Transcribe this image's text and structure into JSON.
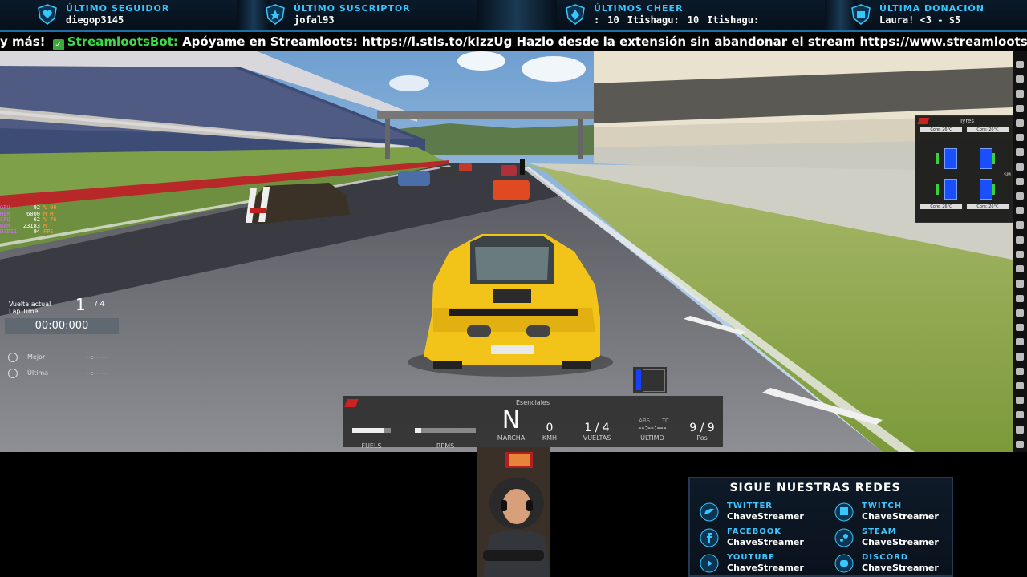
{
  "top_banner": {
    "follower": {
      "label": "ÚLTIMO SEGUIDOR",
      "value": "diegop3145"
    },
    "subscriber": {
      "label": "ÚLTIMO SUSCRIPTOR",
      "value": "jofal93"
    },
    "cheers": {
      "label": "ÚLTIMOS CHEER",
      "items": [
        ":",
        "10",
        "Itishagu:",
        "10",
        "Itishagu:"
      ]
    },
    "donation": {
      "label": "ÚLTIMA DONACIÓN",
      "value": "Laura! <3 - $5"
    }
  },
  "ticker": {
    "prefix": "y más!",
    "bot_name": "StreamlootsBot:",
    "message": "Apóyame en Streamloots: https://l.stls.to/kIzzUg Hazlo desde la extensión sin abandonar el stream https://www.streamloots.com/extensions"
  },
  "game": {
    "tyres_widget": {
      "title": "Tyres",
      "core_labels": [
        "Core: 26°C",
        "Core: 26°C",
        "Core: 26°C",
        "Core: 26°C"
      ],
      "wear_label": "SM"
    },
    "perf_overlay": [
      {
        "key": "GPU",
        "value": "92",
        "unit": "%",
        "extra": "99"
      },
      {
        "key": "MEM",
        "value": "6000",
        "unit": "M",
        "extra": "M"
      },
      {
        "key": "CPU",
        "value": "62",
        "unit": "%",
        "extra": "76"
      },
      {
        "key": "RAM",
        "value": "23183",
        "unit": "M",
        "extra": ""
      },
      {
        "key": "D3D11",
        "value": "94",
        "unit": "FPS",
        "extra": ""
      }
    ],
    "lap_panel": {
      "vuelta_label": "Vuelta actual",
      "laptime_label": "Lap Time",
      "current_lap": "1",
      "lap_of": "/ 4",
      "lap_time": "00:00:000",
      "best_label": "Mejor",
      "best_value": "--:--:---",
      "last_label": "Última",
      "last_value": "--:--:---"
    },
    "hud": {
      "title": "Esenciales",
      "fuel_label": "FUELS",
      "rpm_label": "RPMS",
      "gear": "N",
      "gear_label": "MARCHA",
      "speed": "0",
      "speed_label": "KMH",
      "laps": "1 / 4",
      "laps_label": "VUELTAS",
      "last": "--:--:---",
      "last_label": "ÚLTIMO",
      "abs_label": "ABS",
      "tc_label": "TC",
      "pos": "9 / 9",
      "pos_label": "Pos"
    }
  },
  "social": {
    "title": "SIGUE NUESTRAS REDES",
    "items": [
      {
        "label": "TWITTER",
        "value": "ChaveStreamer",
        "icon": "twitter-icon"
      },
      {
        "label": "TWITCH",
        "value": "ChaveStreamer",
        "icon": "twitch-icon"
      },
      {
        "label": "FACEBOOK",
        "value": "ChaveStreamer",
        "icon": "facebook-icon"
      },
      {
        "label": "STEAM",
        "value": "ChaveStreamer",
        "icon": "steam-icon"
      },
      {
        "label": "YOUTUBE",
        "value": "ChaveStreamer",
        "icon": "youtube-icon"
      },
      {
        "label": "DISCORD",
        "value": "ChaveStreamer",
        "icon": "discord-icon"
      }
    ]
  },
  "colors": {
    "accent": "#36c7ff",
    "bot": "#3ddb4a",
    "car": "#f2c318"
  }
}
